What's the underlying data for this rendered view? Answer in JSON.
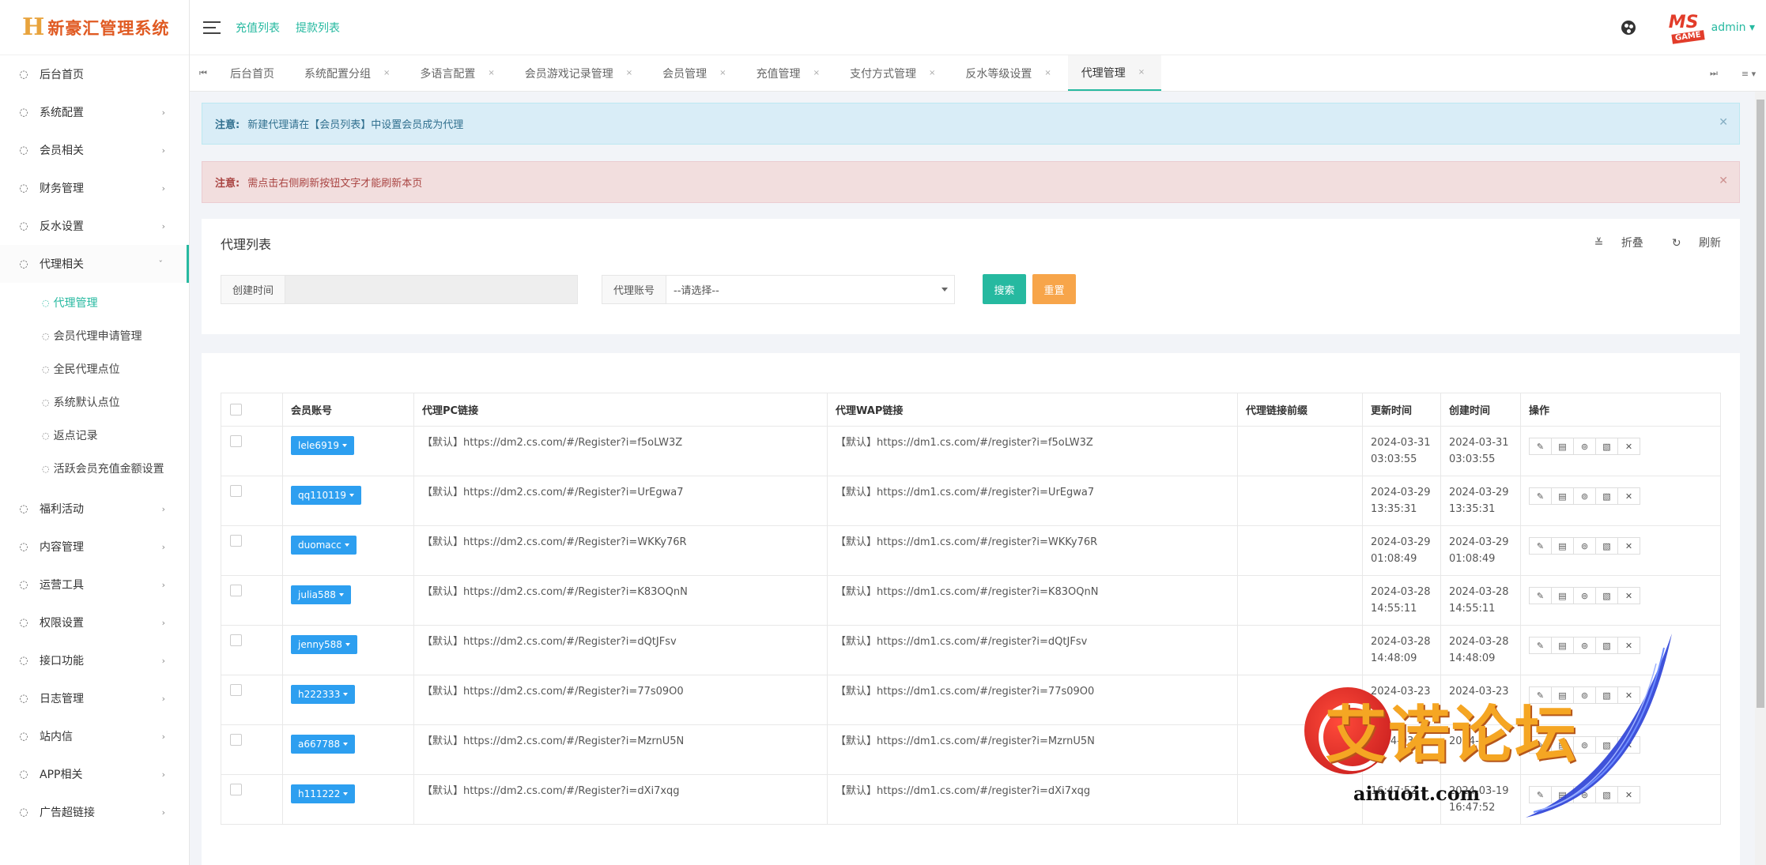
{
  "app": {
    "logo_mark": "H",
    "logo_text": "新豪汇管理系统",
    "brand_color": "#26b9a0"
  },
  "topbar": {
    "links": [
      "充值列表",
      "提款列表"
    ],
    "avatar_text": "MS",
    "avatar_sub": "GAME",
    "user": "admin"
  },
  "sidebar": {
    "items": [
      {
        "label": "后台首页",
        "icon": "circle-icon",
        "arrow": ""
      },
      {
        "label": "系统配置",
        "icon": "circle-icon",
        "arrow": "›"
      },
      {
        "label": "会员相关",
        "icon": "circle-icon",
        "arrow": "›"
      },
      {
        "label": "财务管理",
        "icon": "circle-icon",
        "arrow": "›"
      },
      {
        "label": "反水设置",
        "icon": "circle-icon",
        "arrow": "›"
      },
      {
        "label": "代理相关",
        "icon": "circle-icon",
        "arrow": "ˇ"
      }
    ],
    "subitems": [
      {
        "label": "代理管理",
        "active": true
      },
      {
        "label": "会员代理申请管理"
      },
      {
        "label": "全民代理点位"
      },
      {
        "label": "系统默认点位"
      },
      {
        "label": "返点记录"
      },
      {
        "label": "活跃会员充值金额设置"
      }
    ],
    "items_after": [
      {
        "label": "福利活动",
        "arrow": "›"
      },
      {
        "label": "内容管理",
        "arrow": "›"
      },
      {
        "label": "运营工具",
        "arrow": "›"
      },
      {
        "label": "权限设置",
        "arrow": "›"
      },
      {
        "label": "接口功能",
        "arrow": "›"
      },
      {
        "label": "日志管理",
        "arrow": "›"
      },
      {
        "label": "站内信",
        "arrow": "›"
      },
      {
        "label": "APP相关",
        "arrow": "›"
      },
      {
        "label": "广告超链接",
        "arrow": "›"
      }
    ]
  },
  "tabs": [
    "后台首页",
    "系统配置分组",
    "多语言配置",
    "会员游戏记录管理",
    "会员管理",
    "充值管理",
    "支付方式管理",
    "反水等级设置",
    "代理管理"
  ],
  "alerts": {
    "info_label": "注意:",
    "info_text": "新建代理请在【会员列表】中设置会员成为代理",
    "danger_label": "注意:",
    "danger_text": "需点击右侧刷新按钮文字才能刷新本页"
  },
  "search_panel": {
    "title": "代理列表",
    "collapse_label": "折叠",
    "refresh_label": "刷新",
    "created_label": "创建时间",
    "created_value": "",
    "account_label": "代理账号",
    "account_value": "--请选择--",
    "search_btn": "搜索",
    "reset_btn": "重置"
  },
  "table": {
    "headers": [
      "会员账号",
      "代理PC链接",
      "代理WAP链接",
      "代理链接前缀",
      "更新时间",
      "创建时间",
      "操作"
    ],
    "rows": [
      {
        "account": "lele6919",
        "pc": "【默认】https://dm2.cs.com/#/Register?i=f5oLW3Z",
        "wap": "【默认】https://dm1.cs.com/#/register?i=f5oLW3Z",
        "prefix": "",
        "updated": "2024-03-31 03:03:55",
        "created": "2024-03-31 03:03:55"
      },
      {
        "account": "qq110119",
        "pc": "【默认】https://dm2.cs.com/#/Register?i=UrEgwa7",
        "wap": "【默认】https://dm1.cs.com/#/register?i=UrEgwa7",
        "prefix": "",
        "updated": "2024-03-29 13:35:31",
        "created": "2024-03-29 13:35:31"
      },
      {
        "account": "duomacc",
        "pc": "【默认】https://dm2.cs.com/#/Register?i=WKKy76R",
        "wap": "【默认】https://dm1.cs.com/#/register?i=WKKy76R",
        "prefix": "",
        "updated": "2024-03-29 01:08:49",
        "created": "2024-03-29 01:08:49"
      },
      {
        "account": "julia588",
        "pc": "【默认】https://dm2.cs.com/#/Register?i=K83OQnN",
        "wap": "【默认】https://dm1.cs.com/#/register?i=K83OQnN",
        "prefix": "",
        "updated": "2024-03-28 14:55:11",
        "created": "2024-03-28 14:55:11"
      },
      {
        "account": "jenny588",
        "pc": "【默认】https://dm2.cs.com/#/Register?i=dQtJFsv",
        "wap": "【默认】https://dm1.cs.com/#/register?i=dQtJFsv",
        "prefix": "",
        "updated": "2024-03-28 14:48:09",
        "created": "2024-03-28 14:48:09"
      },
      {
        "account": "h222333",
        "pc": "【默认】https://dm2.cs.com/#/Register?i=77s09O0",
        "wap": "【默认】https://dm1.cs.com/#/register?i=77s09O0",
        "prefix": "",
        "updated": "2024-03-23",
        "created": "2024-03-23"
      },
      {
        "account": "a667788",
        "pc": "【默认】https://dm2.cs.com/#/Register?i=MzrnU5N",
        "wap": "【默认】https://dm1.cs.com/#/register?i=MzrnU5N",
        "prefix": "",
        "updated": "2024-03",
        "created": "2024-03"
      },
      {
        "account": "h111222",
        "pc": "【默认】https://dm2.cs.com/#/Register?i=dXi7xqg",
        "wap": "【默认】https://dm1.cs.com/#/register?i=dXi7xqg",
        "prefix": "",
        "updated": "16:47:52",
        "created": "2024-03-19 16:47:52"
      }
    ],
    "ops": [
      "edit-icon",
      "detail-icon",
      "link-icon",
      "copy-icon",
      "delete-icon"
    ]
  },
  "watermark": {
    "text": "艾诺论坛",
    "url": "ainuoit.com"
  }
}
